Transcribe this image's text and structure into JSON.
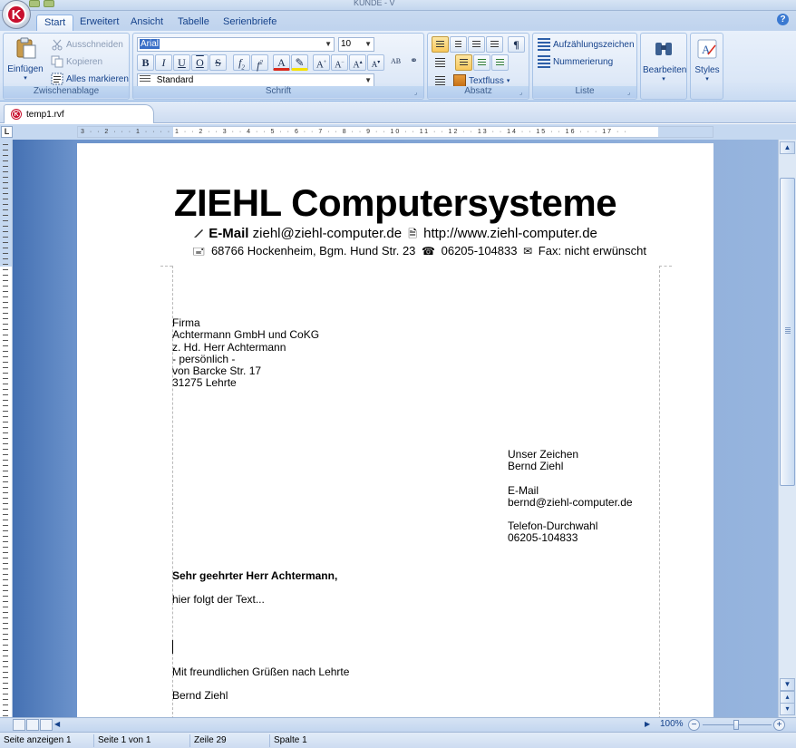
{
  "window": {
    "title": "KUNDE - V"
  },
  "tabs": [
    {
      "label": "Start",
      "active": true
    },
    {
      "label": "Erweitert"
    },
    {
      "label": "Ansicht"
    },
    {
      "label": "Tabelle"
    },
    {
      "label": "Serienbriefe"
    }
  ],
  "ribbon": {
    "clipboard": {
      "paste_label": "Einfügen",
      "cut_label": "Ausschneiden",
      "copy_label": "Kopieren",
      "select_all_label": "Alles markieren",
      "group_label": "Zwischenablage"
    },
    "font": {
      "font_name": "Arial",
      "font_size": "10",
      "style_name": "Standard",
      "group_label": "Schrift"
    },
    "paragraph": {
      "textflow_label": "Textfluss",
      "group_label": "Absatz"
    },
    "list": {
      "bullets_label": "Aufzählungszeichen",
      "numbering_label": "Nummerierung",
      "group_label": "Liste"
    },
    "edit_label": "Bearbeiten",
    "styles_label": "Styles"
  },
  "document_tab": {
    "filename": "temp1.rvf"
  },
  "ruler": {
    "ticks": "3 · · 2 · · · 1 · · · · 1 · · 2 · · 3 · · 4 · · 5 · · 6 · · 7 · · 8 · · 9 · · 10 · · 11 · · 12 · · 13 · · 14 · · 15 · · 16 · · · 17 · ·"
  },
  "letter": {
    "company": "ZIEHL Computersysteme",
    "email_label": "E-Mail",
    "email": "ziehl@ziehl-computer.de",
    "website": "http://www.ziehl-computer.de",
    "address": "68766 Hockenheim, Bgm. Hund Str. 23",
    "phone": "06205-104833",
    "fax": "Fax: nicht erwünscht",
    "recipient": [
      "Firma",
      "Achtermann GmbH und CoKG",
      "z. Hd. Herr Achtermann",
      "- persönlich -",
      "von Barcke Str. 17",
      "31275 Lehrte"
    ],
    "ref_label": "Unser Zeichen",
    "ref_value": "Bernd Ziehl",
    "mail_label": "E-Mail",
    "mail_value": "bernd@ziehl-computer.de",
    "phone_label": "Telefon-Durchwahl",
    "phone_value": "06205-104833",
    "salutation": "Sehr geehrter Herr Achtermann,",
    "body": "hier folgt der Text...",
    "closing": "Mit freundlichen Grüßen nach Lehrte",
    "signature": "Bernd Ziehl"
  },
  "zoom": {
    "label": "100%",
    "level_percent": 100
  },
  "status": {
    "pages_shown": "Seite anzeigen 1",
    "page": "Seite 1 von 1",
    "line": "Zeile 29",
    "column": "Spalte 1"
  },
  "colors": {
    "accent": "#15428b",
    "brand_red": "#c8102e",
    "ribbon_bg": "#dbe7f7"
  }
}
